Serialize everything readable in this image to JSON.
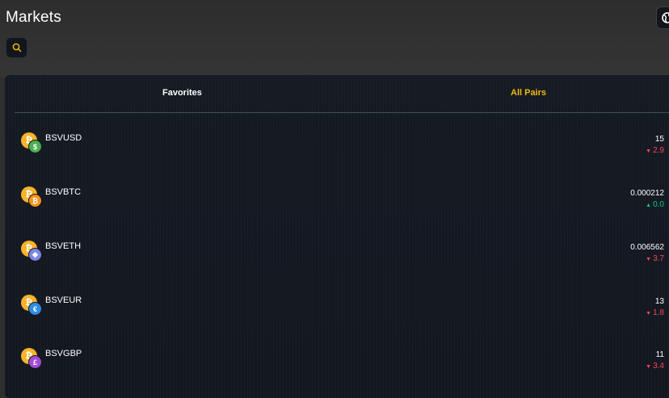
{
  "header": {
    "title": "Markets"
  },
  "tabs": [
    {
      "label": "Favorites",
      "active": false
    },
    {
      "label": "All Pairs",
      "active": true
    }
  ],
  "colors": {
    "accent": "#f0b90b",
    "down": "#f6465d",
    "up": "#0ecb81",
    "panel": "#141821"
  },
  "pairs": [
    {
      "name": "BSVUSD",
      "price": "15",
      "change": "2.9",
      "direction": "down",
      "quote_icon": "dollar-icon",
      "quote_color": "#4caf50"
    },
    {
      "name": "BSVBTC",
      "price": "0.000212",
      "change": "0.0",
      "direction": "up",
      "quote_icon": "bitcoin-icon",
      "quote_color": "#f7931a"
    },
    {
      "name": "BSVETH",
      "price": "0.006562",
      "change": "3.7",
      "direction": "down",
      "quote_icon": "ethereum-icon",
      "quote_color": "#7b86e8"
    },
    {
      "name": "BSVEUR",
      "price": "13",
      "change": "1.8",
      "direction": "down",
      "quote_icon": "euro-icon",
      "quote_color": "#2f8de4"
    },
    {
      "name": "BSVGBP",
      "price": "11",
      "change": "3.4",
      "direction": "down",
      "quote_icon": "pound-icon",
      "quote_color": "#a24bd6"
    }
  ]
}
